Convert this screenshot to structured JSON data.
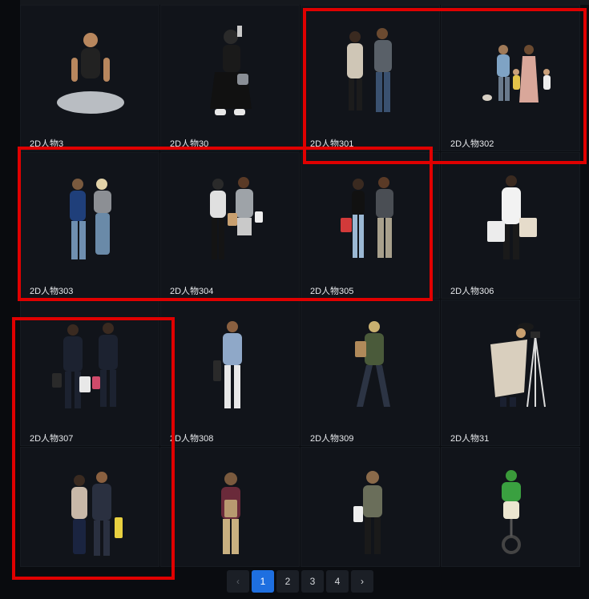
{
  "gallery": {
    "items": [
      {
        "label": "2D人物3"
      },
      {
        "label": "2D人物30"
      },
      {
        "label": "2D人物301"
      },
      {
        "label": "2D人物302"
      },
      {
        "label": "2D人物303"
      },
      {
        "label": "2D人物304"
      },
      {
        "label": "2D人物305"
      },
      {
        "label": "2D人物306"
      },
      {
        "label": "2D人物307"
      },
      {
        "label": "2D人物308"
      },
      {
        "label": "2D人物309"
      },
      {
        "label": "2D人物31"
      },
      {
        "label": ""
      },
      {
        "label": ""
      },
      {
        "label": ""
      },
      {
        "label": ""
      }
    ]
  },
  "pagination": {
    "prev_icon": "chevron-left-icon",
    "next_icon": "chevron-right-icon",
    "pages": [
      "1",
      "2",
      "3",
      "4"
    ],
    "current": "1"
  },
  "colors": {
    "active_page": "#1e6fe0",
    "highlight": "#e00000",
    "tile_bg": "#11141a"
  }
}
